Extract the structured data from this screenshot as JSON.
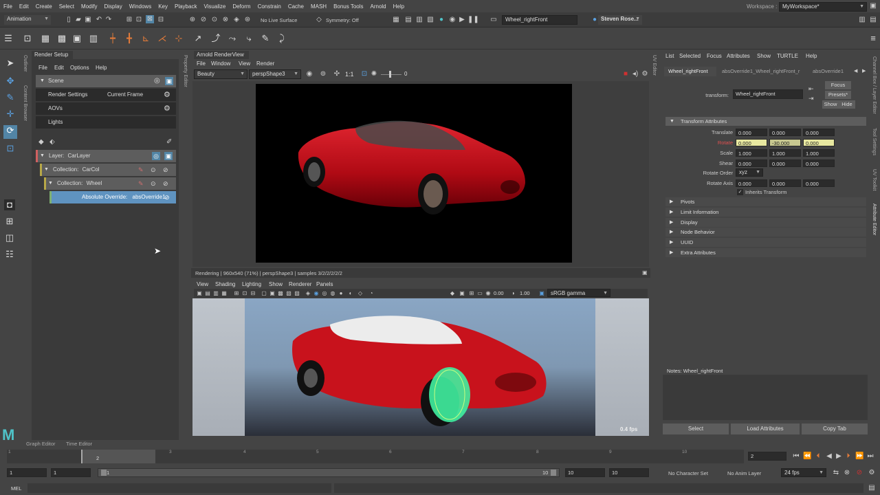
{
  "menubar": {
    "items": [
      "File",
      "Edit",
      "Create",
      "Select",
      "Modify",
      "Display",
      "Windows",
      "Key",
      "Playback",
      "Visualize",
      "Deform",
      "Constrain",
      "Cache",
      "MASH",
      "Bonus Tools",
      "Arnold",
      "Help"
    ],
    "workspace_label": "Workspace :",
    "workspace_value": "MyWorkspace*"
  },
  "statusline": {
    "mode": "Animation",
    "live_surface": "No Live Surface",
    "symmetry": "Symmetry: Off",
    "object_name": "Wheel_rightFront",
    "user": "Steven Rose..."
  },
  "left_tabs": {
    "outliner": "Outliner",
    "content_browser": "Content Browser"
  },
  "render_setup": {
    "title": "Render Setup",
    "menu": [
      "File",
      "Edit",
      "Options",
      "Help"
    ],
    "scene": "Scene",
    "render_settings": "Render Settings",
    "current_frame": "Current Frame",
    "aovs": "AOVs",
    "lights": "Lights",
    "layer_prefix": "Layer:",
    "layer": "CarLayer",
    "collection_prefix": "Collection:",
    "collection1": "CarCol",
    "collection2": "Wheel",
    "override_prefix": "Absolute Override:",
    "override": "absOverride1"
  },
  "property_editor_tab": "Property Editor",
  "renderview": {
    "title": "Arnold RenderView",
    "menu": [
      "File",
      "Window",
      "View",
      "Render"
    ],
    "aov": "Beauty",
    "camera": "perspShape3",
    "ratio": "1:1",
    "exposure": "0",
    "status": "Rendering | 960x540 (71%) | perspShape3 | samples 3/2/2/2/2/2"
  },
  "viewport": {
    "menu": [
      "View",
      "Shading",
      "Lighting",
      "Show",
      "Renderer",
      "Panels"
    ],
    "val1": "0.00",
    "val2": "1.00",
    "colorspace": "sRGB gamma",
    "fps": "0.4 fps"
  },
  "uv_editor_tab": "UV Editor",
  "attribute_editor": {
    "menu": [
      "List",
      "Selected",
      "Focus",
      "Attributes",
      "Show",
      "TURTLE",
      "Help"
    ],
    "tabs": [
      "Wheel_rightFront",
      "absOverride1_Wheel_rightFront_r",
      "absOverride1"
    ],
    "transform_label": "transform:",
    "transform_value": "Wheel_rightFront",
    "focus": "Focus",
    "presets": "Presets*",
    "show": "Show",
    "hide": "Hide",
    "section_transform": "Transform Attributes",
    "translate_label": "Translate",
    "translate": [
      "0.000",
      "0.000",
      "0.000"
    ],
    "rotate_label": "Rotate",
    "rotate": [
      "0.000",
      "-30.000",
      "0.000"
    ],
    "scale_label": "Scale",
    "scale": [
      "1.000",
      "1.000",
      "1.000"
    ],
    "shear_label": "Shear",
    "shear": [
      "0.000",
      "0.000",
      "0.000"
    ],
    "rotate_order_label": "Rotate Order",
    "rotate_order": "xyz",
    "rotate_axis_label": "Rotate Axis",
    "rotate_axis": [
      "0.000",
      "0.000",
      "0.000"
    ],
    "inherits": "Inherits Transform",
    "sections": [
      "Pivots",
      "Limit Information",
      "Display",
      "Node Behavior",
      "UUID",
      "Extra Attributes"
    ],
    "notes": "Notes: Wheel_rightFront",
    "select_btn": "Select",
    "load_btn": "Load Attributes",
    "copy_btn": "Copy Tab"
  },
  "right_tabs": [
    "Channel Box / Layer Editor",
    "Tool Settings",
    "UV Toolkit",
    "Attribute Editor"
  ],
  "bottom_tabs": [
    "Graph Editor",
    "Time Editor"
  ],
  "timeline": {
    "ticks": [
      "1",
      "2",
      "3",
      "4",
      "5",
      "6",
      "7",
      "8",
      "9",
      "10"
    ],
    "current": "2",
    "range_start": "1",
    "range_start2": "1",
    "range_slider_start": "1",
    "range_slider_end": "10",
    "range_end": "10",
    "range_end2": "10",
    "character_set": "No Character Set",
    "anim_layer": "No Anim Layer",
    "fps": "24 fps"
  },
  "command_line": {
    "label": "MEL"
  },
  "colors": {
    "accent": "#5285a6",
    "selected_row": "#5f93c0",
    "red_attr": "#e05050",
    "car": "#c0141c"
  }
}
